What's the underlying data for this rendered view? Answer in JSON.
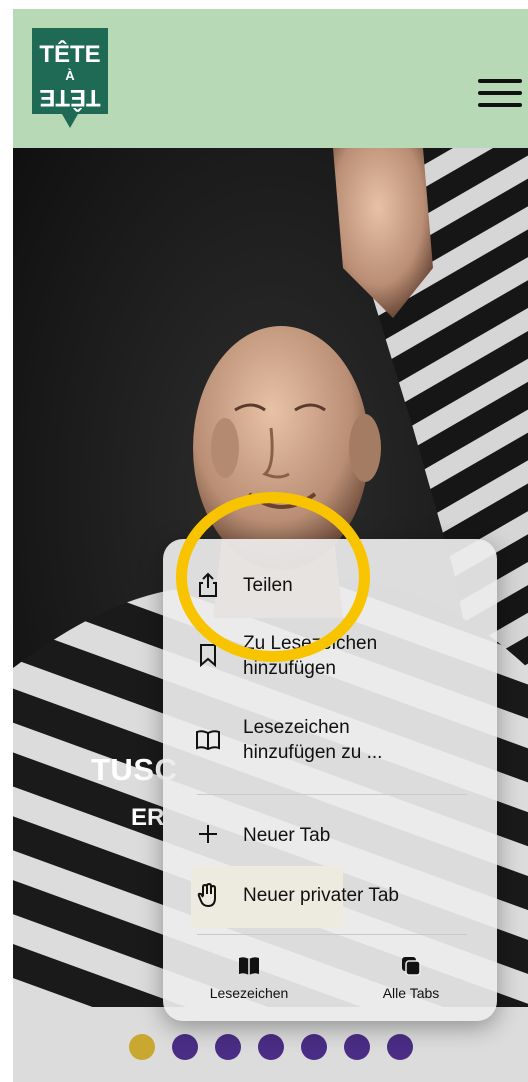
{
  "logo": {
    "line1": "TÊTE",
    "line2": "À",
    "line3": "TÊTE",
    "colors": {
      "bg": "#1f6a55",
      "fg": "#ffffff"
    }
  },
  "header": {
    "menu_icon": "hamburger-icon",
    "bg": "#b7d9b6"
  },
  "hero": {
    "title": "TUSC",
    "subtitle": "ER"
  },
  "context_menu": {
    "items": [
      {
        "label": "Teilen",
        "icon": "share-icon"
      },
      {
        "label": "Zu Lesezeichen\nhinzufügen",
        "icon": "bookmark-icon"
      },
      {
        "label": "Lesezeichen\nhinzufügen zu ...",
        "icon": "book-icon"
      },
      {
        "label": "Neuer Tab",
        "icon": "plus-icon"
      },
      {
        "label": "Neuer privater Tab",
        "icon": "hand-icon"
      }
    ],
    "bottom": [
      {
        "label": "Lesezeichen",
        "icon": "bookmarks-icon"
      },
      {
        "label": "Alle Tabs",
        "icon": "tabs-icon"
      }
    ]
  },
  "carousel": {
    "count": 7,
    "active_index": 0,
    "colors": {
      "active": "#c9a832",
      "inactive": "#4a2d85"
    }
  },
  "annotation": {
    "color": "#f8c400"
  }
}
